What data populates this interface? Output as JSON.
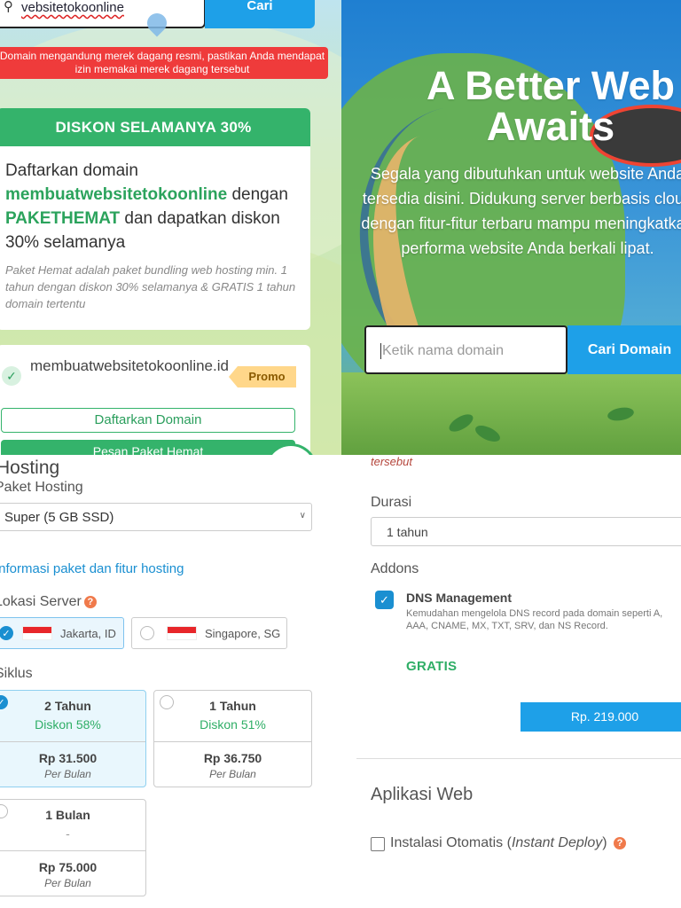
{
  "top_left": {
    "search_value": "vebsitetokoonline",
    "search_button": "Cari",
    "warning": "Domain mengandung merek dagang resmi, pastikan Anda mendapat izin memakai merek dagang tersebut",
    "discount_title": "DISKON SELAMANYA  30%",
    "promo_text_1": "Daftarkan domain ",
    "promo_domain": "membuatwebsitetokoonline",
    "promo_text_2": " dengan ",
    "promo_package": "PAKETHEMAT",
    "promo_text_3": " dan dapatkan diskon 30% selamanya",
    "promo_note": "Paket Hemat adalah paket bundling web hosting min. 1 tahun dengan diskon 30% selamanya & GRATIS 1 tahun domain tertentu",
    "domain_result": "membuatwebsitetokoonline.id",
    "promo_badge": "Promo",
    "register_button": "Daftarkan Domain",
    "order_button": "Pesan Paket Hemat"
  },
  "top_right": {
    "title_line1": "A Better Web",
    "title_line2": "Awaits",
    "description": "Segala yang dibutuhkan untuk website Anda tersedia disini. Didukung server berbasis cloud dengan fitur-fitur terbaru mampu meningkatkan performa website Anda berkali lipat.",
    "input_placeholder": "Ketik nama domain",
    "search_button": "Cari Domain"
  },
  "bottom_left": {
    "section_title": "Hosting",
    "package_label": "Paket Hosting",
    "package_selected": "Super (5 GB SSD)",
    "info_link": "Informasi paket dan fitur hosting",
    "server_label": "Lokasi Server",
    "servers": [
      {
        "label": "Jakarta, ID",
        "selected": true
      },
      {
        "label": "Singapore, SG",
        "selected": false
      }
    ],
    "cycle_label": "Siklus",
    "cycles": [
      {
        "period": "2 Tahun",
        "discount": "Diskon 58%",
        "price": "Rp 31.500",
        "unit": "Per Bulan",
        "selected": true
      },
      {
        "period": "1 Tahun",
        "discount": "Diskon 51%",
        "price": "Rp 36.750",
        "unit": "Per Bulan",
        "selected": false
      },
      {
        "period": "1 Bulan",
        "discount": "-",
        "price": "Rp 75.000",
        "unit": "Per Bulan",
        "selected": false
      }
    ]
  },
  "bottom_right": {
    "trailing_text": "tersebut",
    "duration_label": "Durasi",
    "duration_value": "1 tahun",
    "addons_label": "Addons",
    "addon_name": "DNS Management",
    "addon_desc": "Kemudahan mengelola DNS record pada domain seperti A, AAA, CNAME, MX, TXT, SRV, dan NS Record.",
    "addon_price": "GRATIS",
    "price_button": "Rp. 219.000",
    "apps_title": "Aplikasi Web",
    "auto_install_text": "Instalasi Otomatis (",
    "auto_install_italic": "Instant Deploy",
    "auto_install_close": ")"
  },
  "colors": {
    "accent_blue": "#1ea0e8",
    "green": "#34b36b",
    "warning_red": "#ef3b3b",
    "help_orange": "#f07a4b"
  }
}
